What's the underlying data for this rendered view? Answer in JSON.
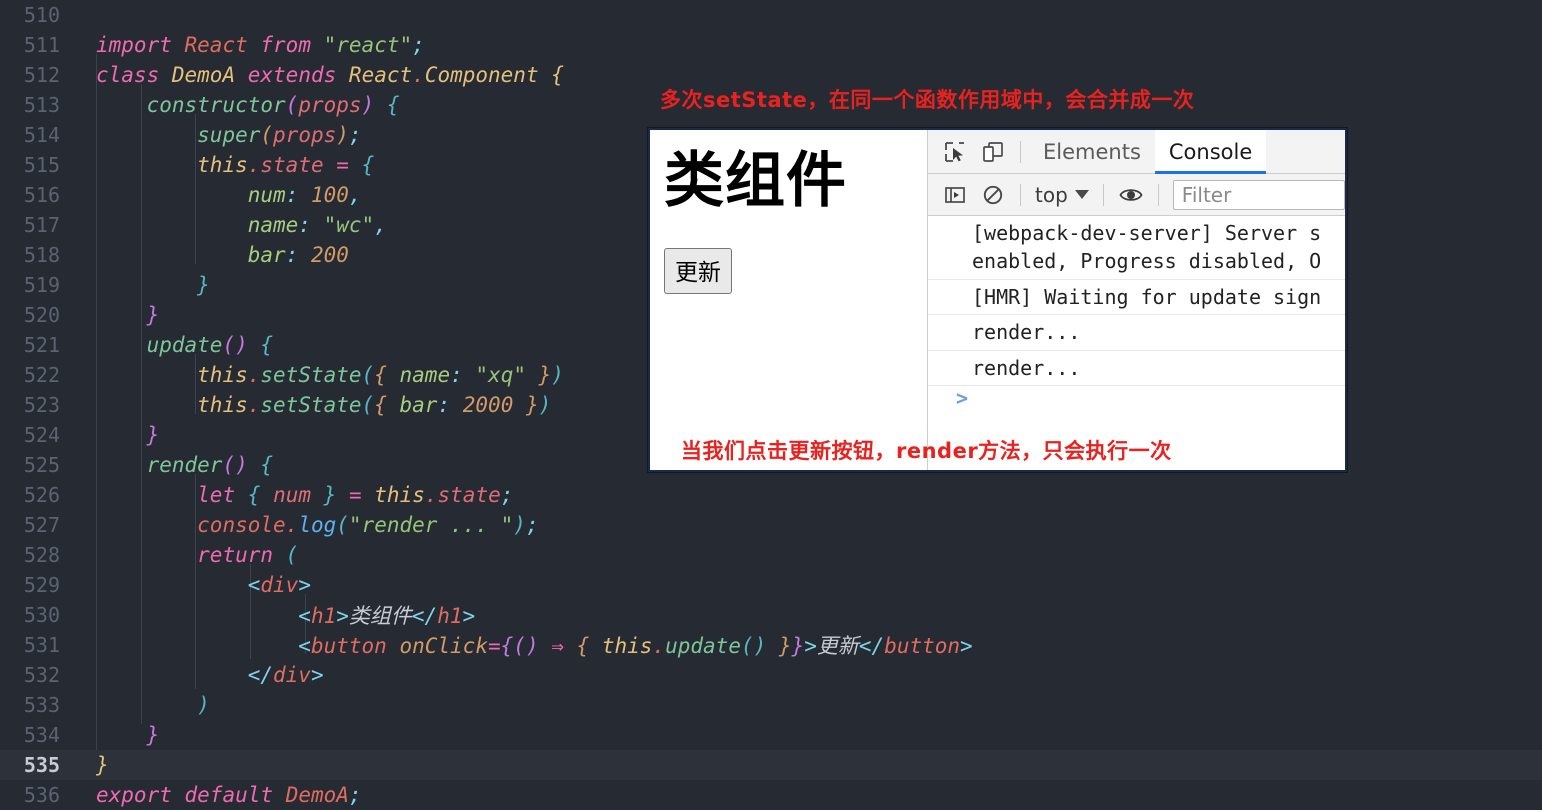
{
  "editor": {
    "first_line_number": 510,
    "active_line": 535,
    "lines": [
      {
        "num": "510",
        "text": ""
      },
      {
        "num": "511",
        "text": "import React from \"react\";"
      },
      {
        "num": "512",
        "text": "class DemoA extends React.Component {"
      },
      {
        "num": "513",
        "text": "    constructor(props) {"
      },
      {
        "num": "514",
        "text": "        super(props);"
      },
      {
        "num": "515",
        "text": "        this.state = {"
      },
      {
        "num": "516",
        "text": "            num: 100,"
      },
      {
        "num": "517",
        "text": "            name: \"wc\","
      },
      {
        "num": "518",
        "text": "            bar: 200"
      },
      {
        "num": "519",
        "text": "        }"
      },
      {
        "num": "520",
        "text": "    }"
      },
      {
        "num": "521",
        "text": "    update() {"
      },
      {
        "num": "522",
        "text": "        this.setState({ name: \"xq\" })"
      },
      {
        "num": "523",
        "text": "        this.setState({ bar: 2000 })"
      },
      {
        "num": "524",
        "text": "    }"
      },
      {
        "num": "525",
        "text": "    render() {"
      },
      {
        "num": "526",
        "text": "        let { num } = this.state;"
      },
      {
        "num": "527",
        "text": "        console.log(\"render ... \");"
      },
      {
        "num": "528",
        "text": "        return ("
      },
      {
        "num": "529",
        "text": "            <div>"
      },
      {
        "num": "530",
        "text": "                <h1>类组件</h1>"
      },
      {
        "num": "531",
        "text": "                <button onClick={() ⇒ { this.update() }}>更新</button>"
      },
      {
        "num": "532",
        "text": "            </div>"
      },
      {
        "num": "533",
        "text": "        )"
      },
      {
        "num": "534",
        "text": "    }"
      },
      {
        "num": "535",
        "text": "}"
      },
      {
        "num": "536",
        "text": "export default DemoA;"
      }
    ]
  },
  "annotations": {
    "top": "多次setState，在同一个函数作用域中，会合并成一次",
    "bottom": "当我们点击更新按钮，render方法，只会执行一次",
    "color": "#e8221f"
  },
  "browser": {
    "page": {
      "heading": "类组件",
      "button_label": "更新"
    },
    "devtools": {
      "inspect_icon": "inspect-element-icon",
      "device_icon": "device-toolbar-icon",
      "tabs": [
        {
          "label": "Elements",
          "active": false
        },
        {
          "label": "Console",
          "active": true
        }
      ],
      "toolbar": {
        "sidebar_icon": "console-sidebar-icon",
        "clear_icon": "clear-console-icon",
        "context": "top",
        "eye_icon": "live-expression-eye-icon",
        "filter_placeholder": "Filter",
        "filter_value": ""
      },
      "console_messages": [
        "[webpack-dev-server] Server s\nenabled, Progress disabled, O",
        "[HMR] Waiting for update sign",
        "render...",
        "render..."
      ],
      "prompt_symbol": ">"
    }
  },
  "colors": {
    "editor_bg": "#252a33",
    "active_line_bg": "#2c313a",
    "gutter_text": "#5c6370",
    "gutter_active": "#c8ccd4",
    "devtools_chrome": "#f3f3f3",
    "tab_underline": "#1a73e8",
    "annotation_red": "#e8221f",
    "green_marker": "#1fd98a",
    "window_border": "#1b2a47"
  }
}
